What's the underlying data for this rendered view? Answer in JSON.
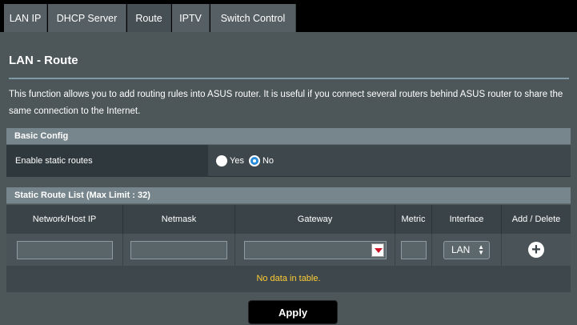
{
  "tabs": [
    {
      "label": "LAN IP"
    },
    {
      "label": "DHCP Server"
    },
    {
      "label": "Route",
      "active": true
    },
    {
      "label": "IPTV"
    },
    {
      "label": "Switch Control"
    }
  ],
  "page": {
    "title": "LAN - Route",
    "description": "This function allows you to add routing rules into ASUS router. It is useful if you connect several routers behind ASUS router to share the same connection to the Internet."
  },
  "basic_config": {
    "header": "Basic Config",
    "enable_static_label": "Enable static routes",
    "yes_label": "Yes",
    "no_label": "No",
    "selected": "No"
  },
  "route_list": {
    "header": "Static Route List (Max Limit : 32)",
    "columns": [
      "Network/Host IP",
      "Netmask",
      "Gateway",
      "Metric",
      "Interface",
      "Add / Delete"
    ],
    "interface_value": "LAN",
    "empty_message": "No data in table."
  },
  "apply_label": "Apply",
  "colors": {
    "accent_radio": "#2a8bd8",
    "empty_text": "#ffcc33",
    "arrow_red": "#d0152a"
  }
}
